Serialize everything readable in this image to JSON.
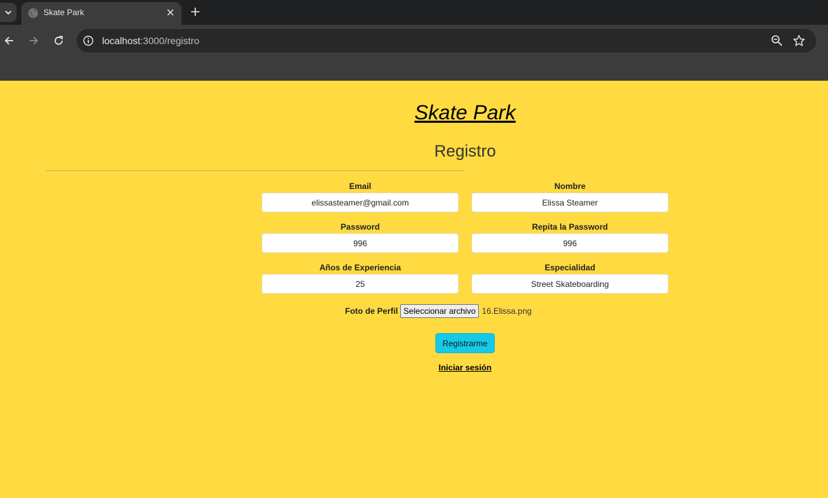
{
  "browser": {
    "tab_title": "Skate Park",
    "url_host": "localhost",
    "url_path": ":3000/registro"
  },
  "page": {
    "site_title": "Skate Park",
    "heading": "Registro"
  },
  "form": {
    "email": {
      "label": "Email",
      "value": "elissasteamer@gmail.com"
    },
    "nombre": {
      "label": "Nombre",
      "value": "Elissa Steamer"
    },
    "password": {
      "label": "Password",
      "value": "996"
    },
    "repeat_password": {
      "label": "Repita la Password",
      "value": "996"
    },
    "experience": {
      "label": "Años de Experiencia",
      "value": "25"
    },
    "specialty": {
      "label": "Especialidad",
      "value": "Street Skateboarding"
    },
    "photo": {
      "label": "Foto de Perfil",
      "button": "Seleccionar archivo",
      "filename": "16.Elissa.png"
    },
    "submit_label": "Registrarme",
    "login_link": "Iniciar sesión"
  },
  "colors": {
    "page_background": "#ffdb41",
    "submit_button": "#16c9e8"
  },
  "icons": [
    "tab-search-icon",
    "globe-icon",
    "close-icon",
    "plus-icon",
    "back-arrow-icon",
    "forward-arrow-icon",
    "reload-icon",
    "info-icon",
    "zoom-icon",
    "star-icon"
  ]
}
